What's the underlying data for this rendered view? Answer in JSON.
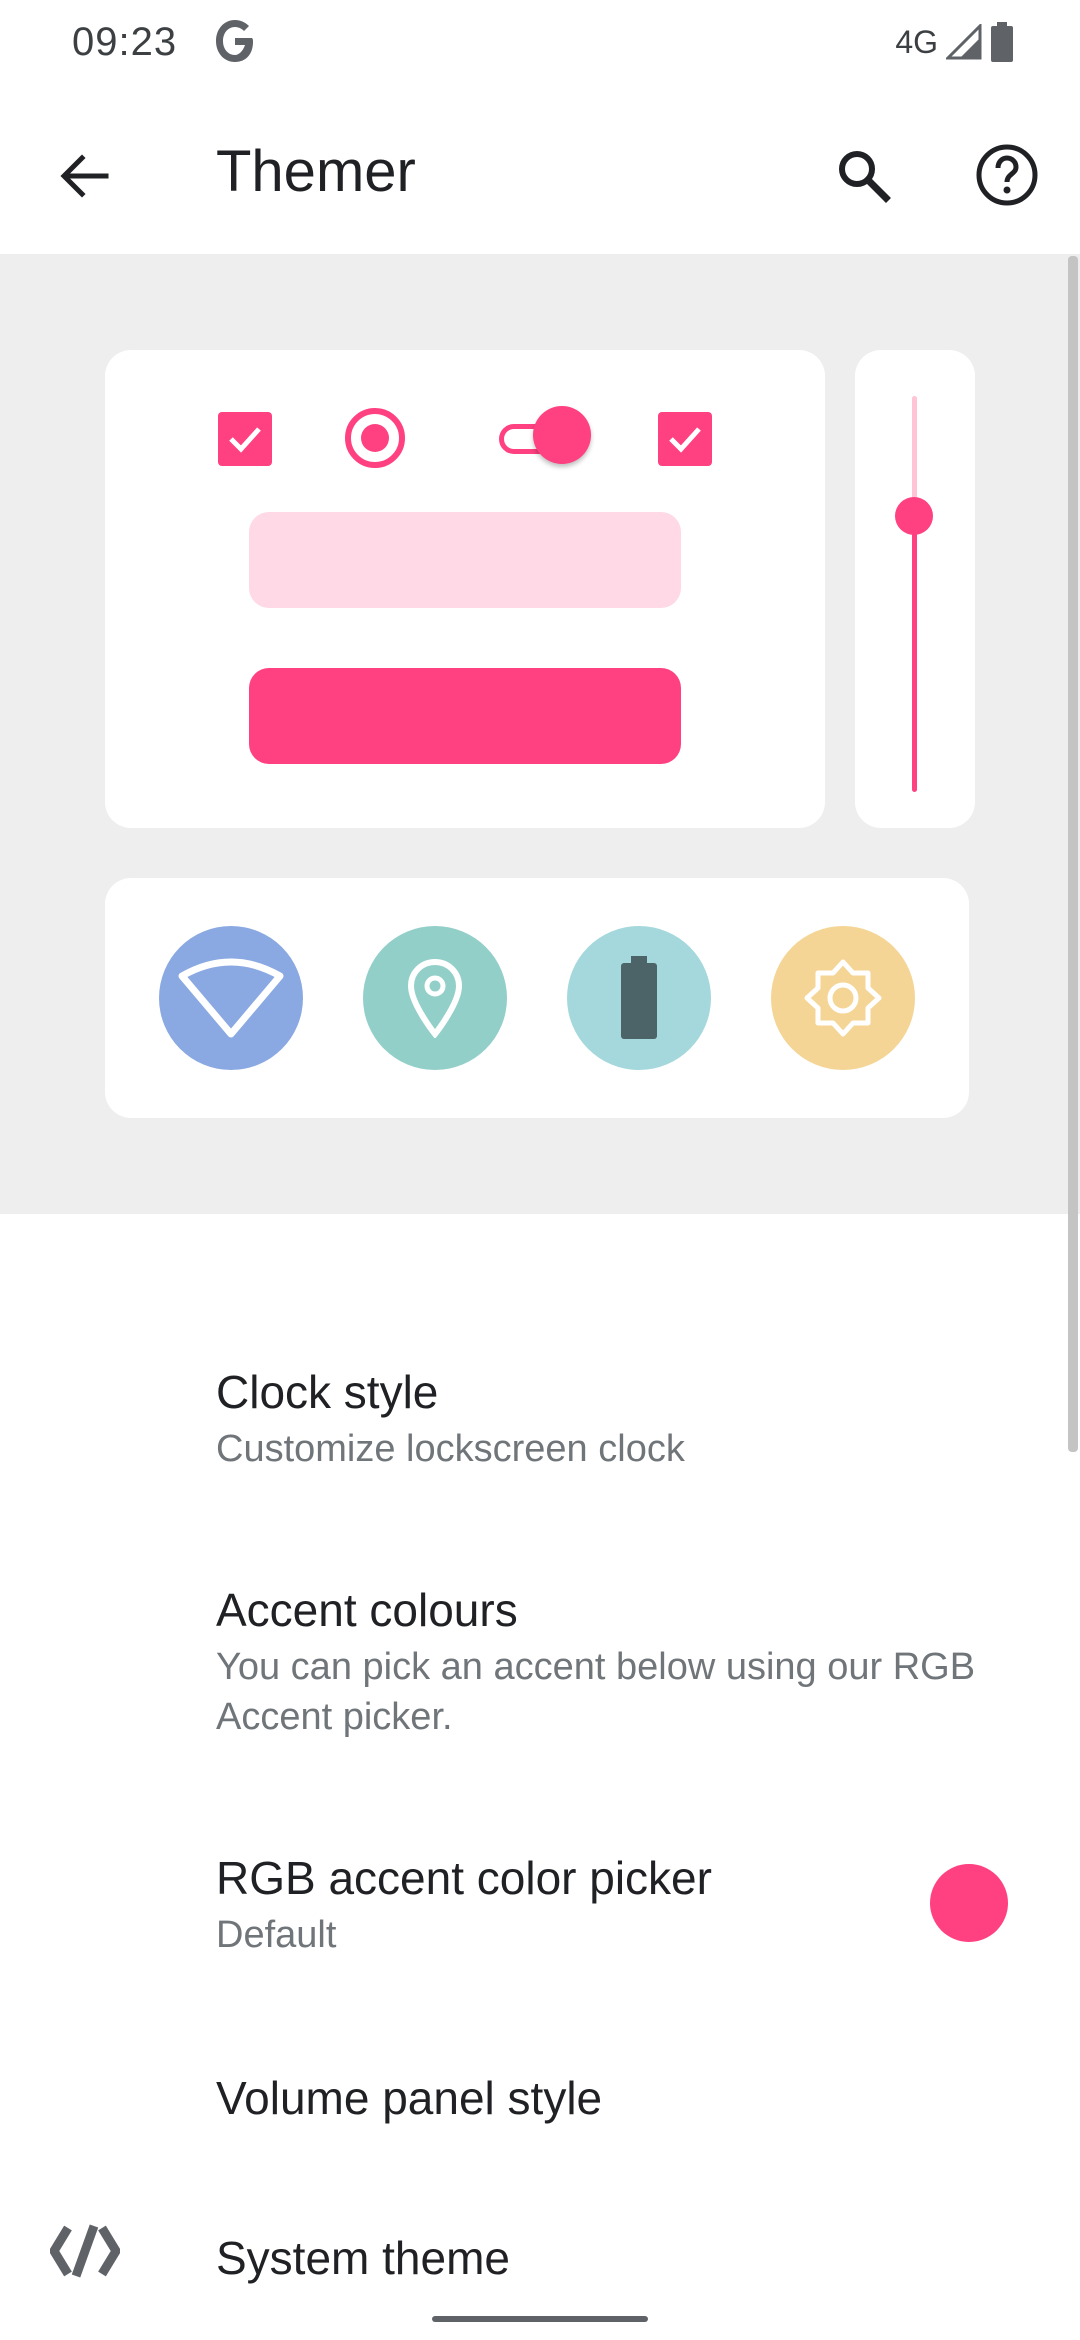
{
  "status_bar": {
    "time": "09:23",
    "network": "4G",
    "icons": [
      "google-g-icon",
      "signal-icon",
      "battery-icon"
    ]
  },
  "app_bar": {
    "title": "Themer",
    "icons": [
      "back-arrow-icon",
      "search-icon",
      "help-icon"
    ]
  },
  "preview": {
    "accent_color": "#ff4081",
    "light_accent_color": "#ffd9e5",
    "background_color": "#eeeeee",
    "slider_level": 0.25,
    "quick_tiles": [
      {
        "name": "wifi-icon",
        "color": "#8aa9e2"
      },
      {
        "name": "location-pin-icon",
        "color": "#92cfc9"
      },
      {
        "name": "battery-icon",
        "color": "#a5d8dc"
      },
      {
        "name": "brightness-icon",
        "color": "#f4d595"
      }
    ]
  },
  "settings": {
    "clock_style": {
      "title": "Clock style",
      "summary": "Customize lockscreen clock"
    },
    "accent_colours": {
      "title": "Accent colours",
      "summary": "You can pick an accent below using our RGB Accent picker."
    },
    "rgb_accent": {
      "title": "RGB accent color picker",
      "summary": "Default",
      "swatch_color": "#ff4081"
    },
    "volume_panel": {
      "title": "Volume panel style"
    },
    "system_theme": {
      "title": "System theme",
      "icon": "code-brackets-icon"
    }
  }
}
